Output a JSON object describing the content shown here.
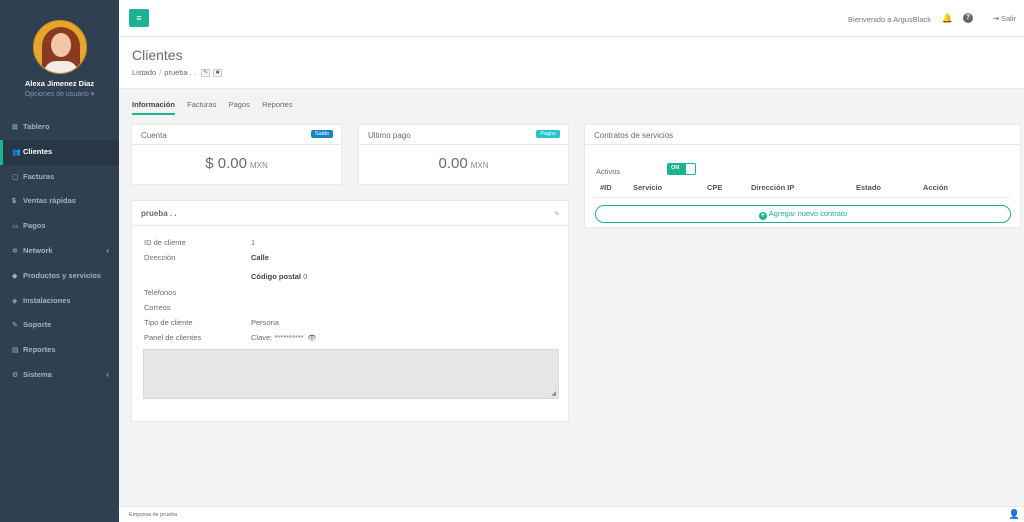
{
  "profile": {
    "name": "Alexa Jimenez Diaz",
    "options": "Opciones de usuario ▾"
  },
  "nav": [
    {
      "icon": "dashboard-icon",
      "glyph": "⊞",
      "label": "Tablero",
      "arrow": ""
    },
    {
      "icon": "users-icon",
      "glyph": "👥",
      "label": "Clientes",
      "arrow": "",
      "active": true
    },
    {
      "icon": "document-icon",
      "glyph": "▢",
      "label": "Facturas",
      "arrow": ""
    },
    {
      "icon": "dollar-icon",
      "glyph": "$",
      "label": "Ventas rápidas",
      "arrow": ""
    },
    {
      "icon": "money-icon",
      "glyph": "▭",
      "label": "Pagos",
      "arrow": ""
    },
    {
      "icon": "network-icon",
      "glyph": "✲",
      "label": "Network",
      "arrow": "‹"
    },
    {
      "icon": "tag-icon",
      "glyph": "◆",
      "label": "Productos y servicios",
      "arrow": ""
    },
    {
      "icon": "install-icon",
      "glyph": "◈",
      "label": "Instalaciones",
      "arrow": ""
    },
    {
      "icon": "wrench-icon",
      "glyph": "✎",
      "label": "Soporte",
      "arrow": ""
    },
    {
      "icon": "book-icon",
      "glyph": "▤",
      "label": "Reportes",
      "arrow": ""
    },
    {
      "icon": "cogs-icon",
      "glyph": "⚙",
      "label": "Sistema",
      "arrow": "‹"
    }
  ],
  "topbar": {
    "menu_glyph": "≡",
    "welcome": "Bienvenido a ArgusBlack",
    "bell_glyph": "🔔",
    "help_glyph": "?",
    "logout": "⇥  Salir"
  },
  "heading": {
    "title": "Clientes",
    "crumb_list": "Listado",
    "crumb_sep": "/",
    "crumb_current": "prueba . .",
    "edit_glyph": "✎",
    "delete_glyph": "■"
  },
  "tabs": [
    "Información",
    "Facturas",
    "Pagos",
    "Reportes"
  ],
  "cuenta": {
    "title": "Cuenta",
    "badge": "Saldo",
    "amount": "$ 0.00",
    "currency": "MXN"
  },
  "ultimo_pago": {
    "title": "Ultimo pago",
    "badge": "Pagos",
    "amount": "0.00",
    "currency": "MXN"
  },
  "client": {
    "title": "prueba . .",
    "edit_glyph": "✎",
    "rows": {
      "id_label": "ID de cliente",
      "id_value": "1",
      "direccion_label": "Dirección",
      "direccion_value": "Calle",
      "cp_label": "Código postal",
      "cp_value": "0",
      "telefonos_label": "Teléfonos",
      "correos_label": "Correos",
      "tipo_label": "Tipo de cliente",
      "tipo_value": "Persona",
      "panel_label": "Panel de clientes",
      "panel_value": "Clave: **********",
      "eye_glyph": "👁"
    },
    "resize_glyph": "◢"
  },
  "contratos": {
    "title": "Contratos de servicios",
    "activos_label": "Activos",
    "toggle_label": "ON",
    "columns": [
      "#ID",
      "Servicio",
      "CPE",
      "Dirección IP",
      "Estado",
      "Acción"
    ],
    "add_plus": "+",
    "add_label": "Agregar nuevo contrato"
  },
  "footer": {
    "company": "Empresa de prueba",
    "user_glyph": "👤"
  }
}
